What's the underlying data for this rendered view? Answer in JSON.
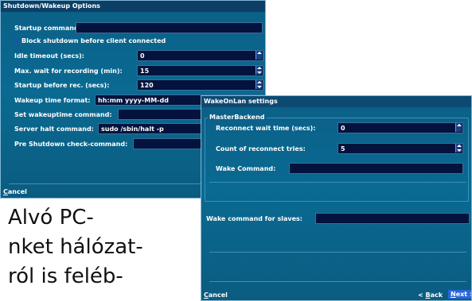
{
  "shutdown_window": {
    "title": "Shutdown/Wakeup Options",
    "startup_command_label": "Startup command:",
    "startup_command_value": "",
    "block_shutdown_label": "Block shutdown before client connected",
    "idle_timeout_label": "Idle timeout (secs):",
    "idle_timeout_value": "0",
    "max_wait_label": "Max. wait for recording (min):",
    "max_wait_value": "15",
    "startup_before_label": "Startup before rec. (secs):",
    "startup_before_value": "120",
    "wakeup_format_label": "Wakeup time format:",
    "wakeup_format_value": "hh:mm yyyy-MM-dd",
    "set_wakeup_label": "Set wakeuptime command:",
    "set_wakeup_value": "",
    "server_halt_label": "Server halt command:",
    "server_halt_value": "sudo /sbin/halt -p",
    "pre_shutdown_label": "Pre Shutdown check-command:",
    "pre_shutdown_value": "",
    "cancel_prefix": "C",
    "cancel_rest": "ancel"
  },
  "wol_window": {
    "title": "WakeOnLan settings",
    "group_label": "MasterBackend",
    "reconnect_wait_label": "Reconnect wait time (secs):",
    "reconnect_wait_value": "0",
    "reconnect_count_label": "Count of reconnect tries:",
    "reconnect_count_value": "5",
    "wake_command_label": "Wake Command:",
    "wake_command_value": "",
    "slaves_label": "Wake command for slaves:",
    "slaves_value": "",
    "cancel_prefix": "C",
    "cancel_rest": "ancel",
    "back_prefix": "< ",
    "back_key": "B",
    "back_rest": "ack",
    "next_key": "N",
    "next_rest": "ext >"
  },
  "caption_lines": [
    "Alvó PC-",
    "nket hálózat-",
    "ról is feléb-"
  ]
}
